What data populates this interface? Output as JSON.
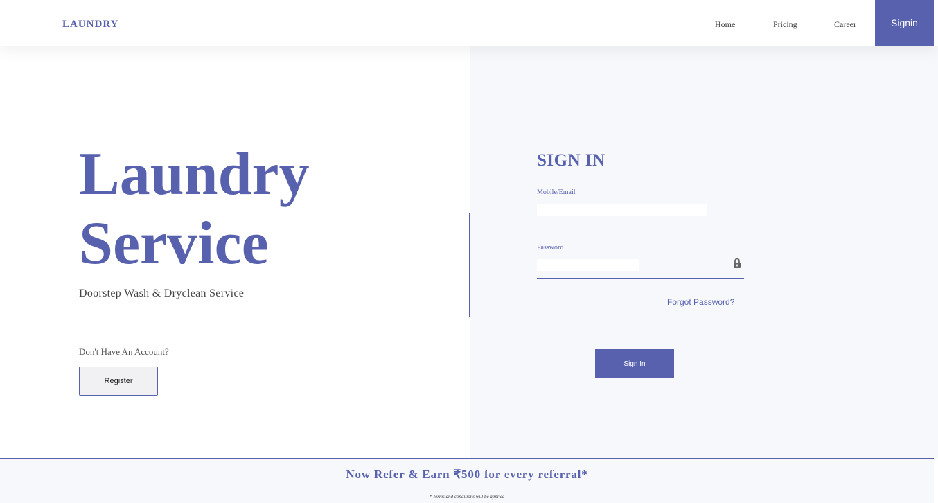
{
  "header": {
    "brand": "LAUNDRY",
    "nav": {
      "home": "Home",
      "pricing": "Pricing",
      "career": "Career",
      "signin": "Signin"
    }
  },
  "hero": {
    "title_line1": "Laundry",
    "title_line2": "Service",
    "subtitle": "Doorstep Wash & Dryclean Service",
    "no_account_text": "Don't Have An Account?",
    "register_label": "Register"
  },
  "signin_form": {
    "title": "SIGN IN",
    "email_label": "Mobile/Email",
    "email_value": "",
    "password_label": "Password",
    "password_value": "",
    "lock_icon": "lock-icon",
    "forgot_label": "Forgot Password?",
    "submit_label": "Sign In"
  },
  "footer": {
    "refer_text": "Now Refer & Earn ₹500 for every referral*",
    "terms_text": "* Terms and conditions will be applied"
  },
  "colors": {
    "accent": "#5861ae",
    "panel_bg": "#f7f8fc"
  }
}
